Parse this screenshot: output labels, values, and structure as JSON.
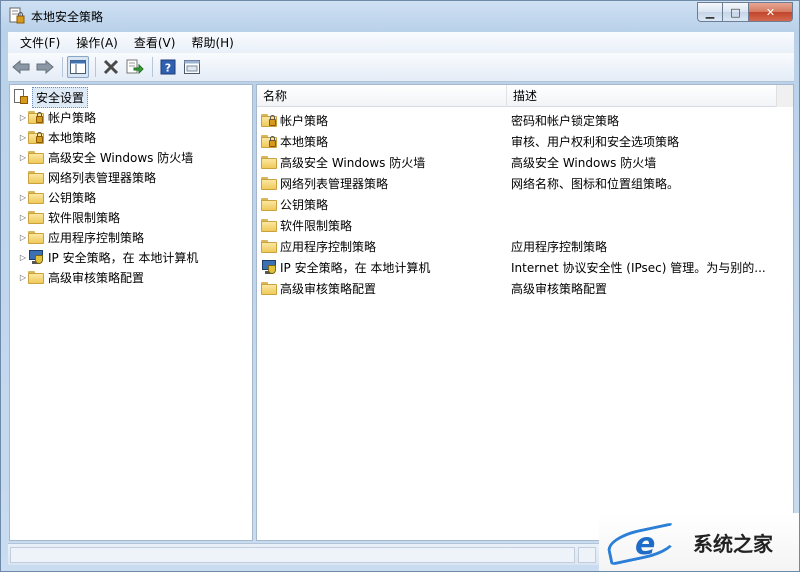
{
  "window": {
    "title": "本地安全策略",
    "controls": {
      "minimize": "▁",
      "maximize": "□",
      "close": "✕"
    }
  },
  "menu": [
    "文件(F)",
    "操作(A)",
    "查看(V)",
    "帮助(H)"
  ],
  "toolbar": {
    "icons": [
      "back-arrow-icon",
      "forward-arrow-icon",
      "show-hide-tree-icon",
      "delete-icon",
      "export-list-icon",
      "help-icon",
      "properties-icon"
    ]
  },
  "tree": {
    "root": "安全设置",
    "items": [
      {
        "label": "帐户策略",
        "icon": "locked-folder-icon",
        "expandable": true
      },
      {
        "label": "本地策略",
        "icon": "locked-folder-icon",
        "expandable": true
      },
      {
        "label": "高级安全 Windows 防火墙",
        "icon": "folder-icon",
        "expandable": true
      },
      {
        "label": "网络列表管理器策略",
        "icon": "folder-icon",
        "expandable": false
      },
      {
        "label": "公钥策略",
        "icon": "folder-icon",
        "expandable": true
      },
      {
        "label": "软件限制策略",
        "icon": "folder-icon",
        "expandable": true
      },
      {
        "label": "应用程序控制策略",
        "icon": "folder-icon",
        "expandable": true
      },
      {
        "label": "IP 安全策略，在 本地计算机",
        "icon": "ip-security-icon",
        "expandable": true
      },
      {
        "label": "高级审核策略配置",
        "icon": "folder-icon",
        "expandable": true
      }
    ]
  },
  "list": {
    "columns": [
      "名称",
      "描述"
    ],
    "rows": [
      {
        "name": "帐户策略",
        "desc": "密码和帐户锁定策略",
        "icon": "locked-folder-icon"
      },
      {
        "name": "本地策略",
        "desc": "审核、用户权利和安全选项策略",
        "icon": "locked-folder-icon"
      },
      {
        "name": "高级安全 Windows 防火墙",
        "desc": "高级安全 Windows 防火墙",
        "icon": "folder-icon"
      },
      {
        "name": "网络列表管理器策略",
        "desc": "网络名称、图标和位置组策略。",
        "icon": "folder-icon"
      },
      {
        "name": "公钥策略",
        "desc": "",
        "icon": "folder-icon"
      },
      {
        "name": "软件限制策略",
        "desc": "",
        "icon": "folder-icon"
      },
      {
        "name": "应用程序控制策略",
        "desc": "应用程序控制策略",
        "icon": "folder-icon"
      },
      {
        "name": "IP 安全策略，在 本地计算机",
        "desc": "Internet 协议安全性 (IPsec) 管理。为与别的...",
        "icon": "ip-security-icon"
      },
      {
        "name": "高级审核策略配置",
        "desc": "高级审核策略配置",
        "icon": "folder-icon"
      }
    ]
  },
  "watermark": {
    "text": "系统之家",
    "logo_letter": "e"
  }
}
